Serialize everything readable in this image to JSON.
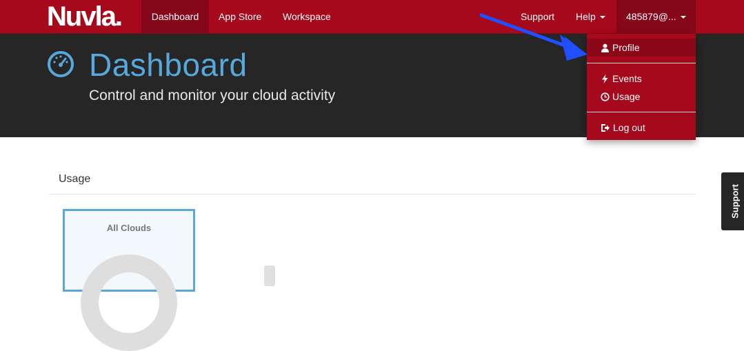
{
  "navbar": {
    "logo_text": "Nuvla.",
    "items": [
      {
        "label": "Dashboard",
        "active": true
      },
      {
        "label": "App Store"
      },
      {
        "label": "Workspace"
      }
    ],
    "right": {
      "support": "Support",
      "help": "Help",
      "user": "485879@..."
    }
  },
  "header": {
    "icon": "gauge-icon",
    "title": "Dashboard",
    "subtitle": "Control and monitor your cloud activity"
  },
  "main": {
    "section_title": "Usage",
    "card": {
      "title": "All Clouds"
    }
  },
  "side_tab": {
    "label": "Support"
  },
  "user_menu": {
    "items": [
      {
        "label": "Profile",
        "icon": "user-icon",
        "hover": true
      },
      {
        "label": "Events",
        "icon": "bolt-icon"
      },
      {
        "label": "Usage",
        "icon": "clock-icon"
      },
      {
        "label": "Log out",
        "icon": "log-out-icon"
      }
    ]
  },
  "colors": {
    "brand": "#a6091c",
    "header_bg": "#262626",
    "accent": "#55a9dc",
    "annotation_arrow": "#1f4fff"
  }
}
